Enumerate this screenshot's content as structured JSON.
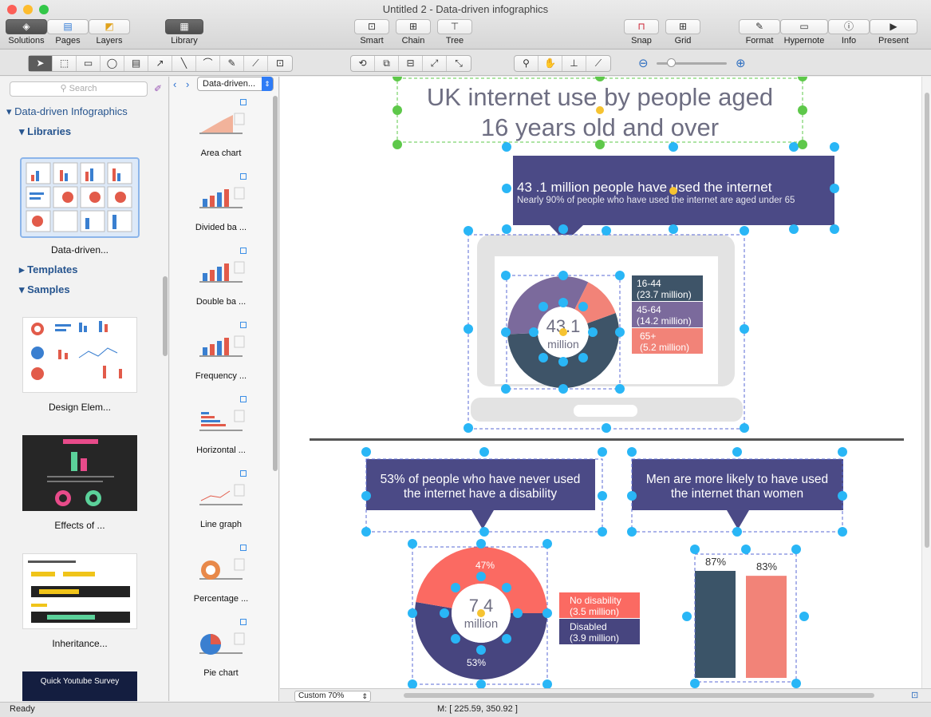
{
  "window": {
    "title": "Untitled 2 - Data-driven infographics"
  },
  "toolbar": {
    "solutions": "Solutions",
    "pages": "Pages",
    "layers": "Layers",
    "library": "Library",
    "smart": "Smart",
    "chain": "Chain",
    "tree": "Tree",
    "snap": "Snap",
    "grid": "Grid",
    "format": "Format",
    "hypernote": "Hypernote",
    "info": "Info",
    "present": "Present"
  },
  "sidebar": {
    "search_placeholder": "Search",
    "root": "Data-driven Infographics",
    "libraries": "Libraries",
    "library_thumb_label": "Data-driven...",
    "templates": "Templates",
    "samples": "Samples",
    "sample_items": [
      "Design Elem...",
      "Effects of ...",
      "Inheritance..."
    ],
    "sample_4_title": "Quick Youtube Survey"
  },
  "library_panel": {
    "dropdown": "Data-driven...",
    "items": [
      "Area chart",
      "Divided ba ...",
      "Double ba ...",
      "Frequency ...",
      "Horizontal  ...",
      "Line graph",
      "Percentage ...",
      "Pie chart"
    ]
  },
  "infographic": {
    "title_line1": "UK internet use by people aged",
    "title_line2": "16 years old and over",
    "callout1_title": "43 .1 million people have used the internet",
    "callout1_sub": "Nearly 90% of people who have used the internet are aged under 65",
    "donut1_value": "43.1",
    "donut1_unit": "million",
    "legend1": [
      {
        "l1": "16-44",
        "l2": "(23.7 million)",
        "color": "#3e5468"
      },
      {
        "l1": "45-64",
        "l2": "(14.2 million)",
        "color": "#7b6a9c"
      },
      {
        "l1": "65+",
        "l2": "(5.2 million)",
        "color": "#f28378"
      }
    ],
    "callout2": "53% of people who have never used the internet have a disability",
    "callout3": "Men are more likely to have used the internet than women",
    "donut2_value": "7.4",
    "donut2_unit": "million",
    "donut2_top_pct": "47%",
    "donut2_bottom_pct": "53%",
    "legend2": [
      {
        "l1": "No disability",
        "l2": "(3.5 million)",
        "color": "#fb6a62"
      },
      {
        "l1": "Disabled",
        "l2": "(3.9 million)",
        "color": "#47457f"
      }
    ],
    "bars": [
      {
        "label": "87%",
        "value": 87,
        "color": "#3b5468"
      },
      {
        "label": "83%",
        "value": 83,
        "color": "#f28378"
      }
    ]
  },
  "chart_data": [
    {
      "type": "pie",
      "categories": [
        "16-44",
        "45-64",
        "65+"
      ],
      "values": [
        23.7,
        14.2,
        5.2
      ]
    },
    {
      "type": "pie",
      "categories": [
        "No disability",
        "Disabled"
      ],
      "values": [
        3.5,
        3.9
      ]
    },
    {
      "type": "bar",
      "categories": [
        "",
        ""
      ],
      "values": [
        87,
        83
      ]
    }
  ],
  "bottom": {
    "zoom": "Custom 70%"
  },
  "status": {
    "left": "Ready",
    "coords": "M: [ 225.59, 350.92 ]"
  }
}
